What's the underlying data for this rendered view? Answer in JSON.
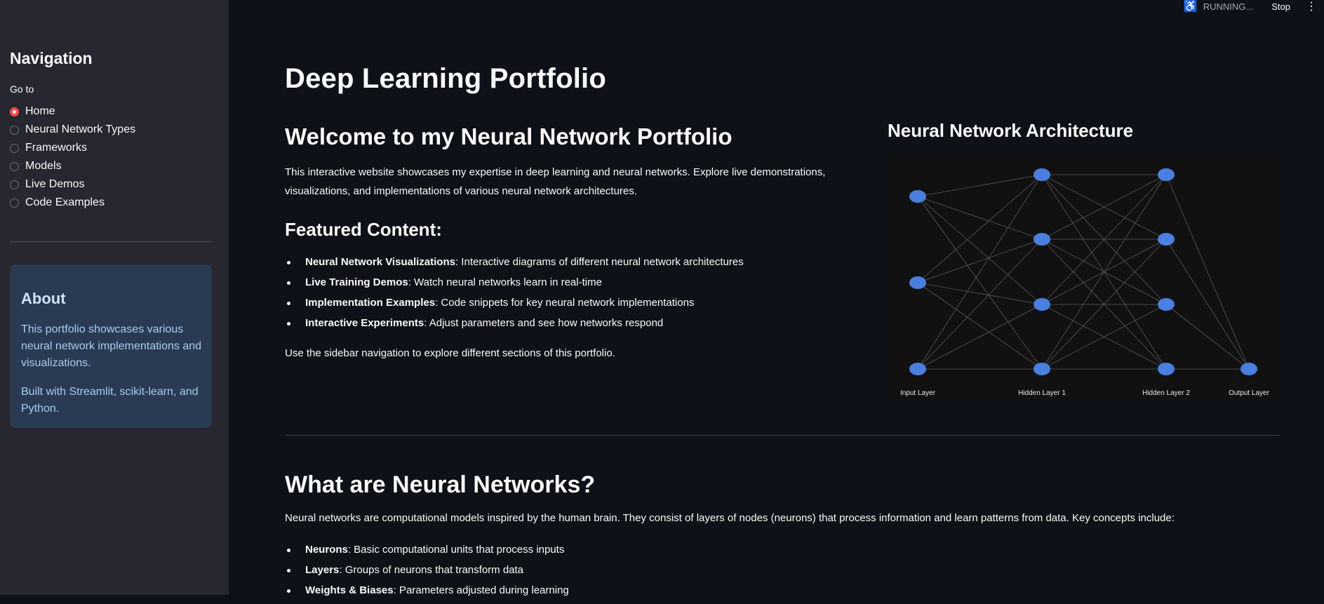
{
  "topbar": {
    "status_text": "RUNNING...",
    "stop_label": "Stop",
    "running_icon": "running-figure-icon",
    "menu_icon": "kebab-menu-icon"
  },
  "sidebar": {
    "title": "Navigation",
    "radio_label": "Go to",
    "items": [
      {
        "label": "Home",
        "selected": true
      },
      {
        "label": "Neural Network Types",
        "selected": false
      },
      {
        "label": "Frameworks",
        "selected": false
      },
      {
        "label": "Models",
        "selected": false
      },
      {
        "label": "Live Demos",
        "selected": false
      },
      {
        "label": "Code Examples",
        "selected": false
      }
    ],
    "about": {
      "title": "About",
      "text1": "This portfolio showcases various neural network implementations and visualizations.",
      "text2": "Built with Streamlit, scikit-learn, and Python."
    }
  },
  "main": {
    "title": "Deep Learning Portfolio",
    "welcome_title": "Welcome to my Neural Network Portfolio",
    "intro": "This interactive website showcases my expertise in deep learning and neural networks. Explore live demonstrations, visualizations, and implementations of various neural network architectures.",
    "featured_title": "Featured Content:",
    "featured": [
      {
        "bold": "Neural Network Visualizations",
        "rest": ": Interactive diagrams of different neural network architectures"
      },
      {
        "bold": "Live Training Demos",
        "rest": ": Watch neural networks learn in real-time"
      },
      {
        "bold": "Implementation Examples",
        "rest": ": Code snippets for key neural network implementations"
      },
      {
        "bold": "Interactive Experiments",
        "rest": ": Adjust parameters and see how networks respond"
      }
    ],
    "use_sidebar": "Use the sidebar navigation to explore different sections of this portfolio.",
    "what_title": "What are Neural Networks?",
    "what_text": "Neural networks are computational models inspired by the human brain. They consist of layers of nodes (neurons) that process information and learn patterns from data. Key concepts include:",
    "concepts": [
      {
        "bold": "Neurons",
        "rest": ": Basic computational units that process inputs"
      },
      {
        "bold": "Layers",
        "rest": ": Groups of neurons that transform data"
      },
      {
        "bold": "Weights & Biases",
        "rest": ": Parameters adjusted during learning"
      }
    ]
  },
  "architecture": {
    "title": "Neural Network Architecture",
    "node_color": "#4a7fe0",
    "edge_color": "#5a5a5a",
    "layers": [
      {
        "label": "Input Layer",
        "nodes": 3
      },
      {
        "label": "Hidden Layer 1",
        "nodes": 4
      },
      {
        "label": "Hidden Layer 2",
        "nodes": 4
      },
      {
        "label": "Output Layer",
        "nodes": 1
      }
    ]
  }
}
